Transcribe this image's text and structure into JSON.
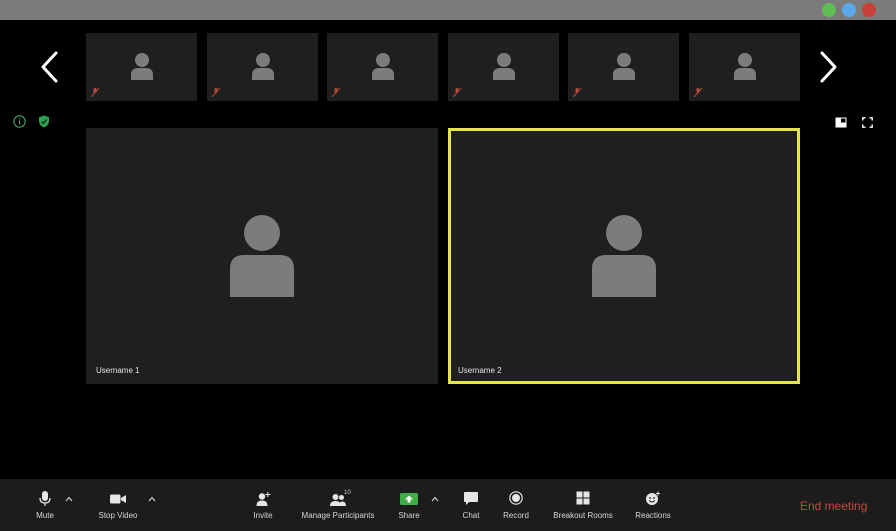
{
  "window": {
    "buttons": [
      "zoom-button",
      "minimize-button",
      "close-button"
    ],
    "colors": {
      "green": "#5fbf55",
      "blue": "#5aa7ea",
      "red": "#c9403a"
    }
  },
  "gallery": {
    "thumbnails": [
      {
        "muted": true
      },
      {
        "muted": true
      },
      {
        "muted": true
      },
      {
        "muted": true
      },
      {
        "muted": true
      },
      {
        "muted": true
      }
    ]
  },
  "participants": [
    {
      "name": "Username 1",
      "active_speaker": false
    },
    {
      "name": "Username 2",
      "active_speaker": true
    }
  ],
  "toolbar": {
    "mute": "Mute",
    "stop_video": "Stop Video",
    "invite": "Invite",
    "manage_participants": "Manage Participants",
    "participant_count": "10",
    "share": "Share",
    "chat": "Chat",
    "record": "Record",
    "breakout_rooms": "Breakout Rooms",
    "reactions": "Reactions",
    "end_meeting": "End meeting"
  },
  "colors": {
    "active_speaker_border": "#e7e34a",
    "share_green": "#3fae49",
    "end_meeting": "#c44a3d",
    "tile_bg": "#1f1f1f",
    "toolbar_bg": "#1c1c1c"
  }
}
